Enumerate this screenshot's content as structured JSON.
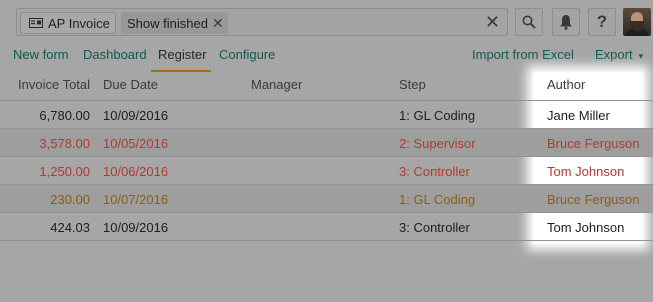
{
  "topbar": {
    "filter_chip_label": "AP Invoice",
    "tag_label": "Show finished",
    "tag_close": "✕",
    "search_clear": "✕",
    "search_icon": "search-icon",
    "bell_icon": "bell-icon",
    "help_label": "?"
  },
  "nav": {
    "new_form": "New form",
    "dashboard": "Dashboard",
    "register": "Register",
    "configure": "Configure",
    "import": "Import from Excel",
    "export": "Export",
    "export_caret": "▾"
  },
  "table": {
    "headers": [
      "Invoice Total",
      "Due Date",
      "Manager",
      "Step",
      "Author"
    ],
    "rows": [
      {
        "total": "6,780.00",
        "due": "10/09/2016",
        "manager": "",
        "step": "1: GL Coding",
        "author": "Jane Miller",
        "color": "#1e1e1e"
      },
      {
        "total": "3,578.00",
        "due": "10/05/2016",
        "manager": "",
        "step": "2: Supervisor",
        "author": "Bruce Ferguson",
        "color": "#b03a30"
      },
      {
        "total": "1,250.00",
        "due": "10/06/2016",
        "manager": "",
        "step": "3: Controller",
        "author": "Tom Johnson",
        "color": "#b03a30"
      },
      {
        "total": "230.00",
        "due": "10/07/2016",
        "manager": "",
        "step": "1: GL Coding",
        "author": "Bruce Ferguson",
        "color": "#8a5e12"
      },
      {
        "total": "424.03",
        "due": "10/09/2016",
        "manager": "",
        "step": "3: Controller",
        "author": "Tom Johnson",
        "color": "#1e1e1e"
      }
    ]
  },
  "colors": {
    "accent": "#0e5a50",
    "overdue": "#b03a30",
    "warning": "#8a5e12",
    "active_tab_underline": "#a06f17"
  }
}
